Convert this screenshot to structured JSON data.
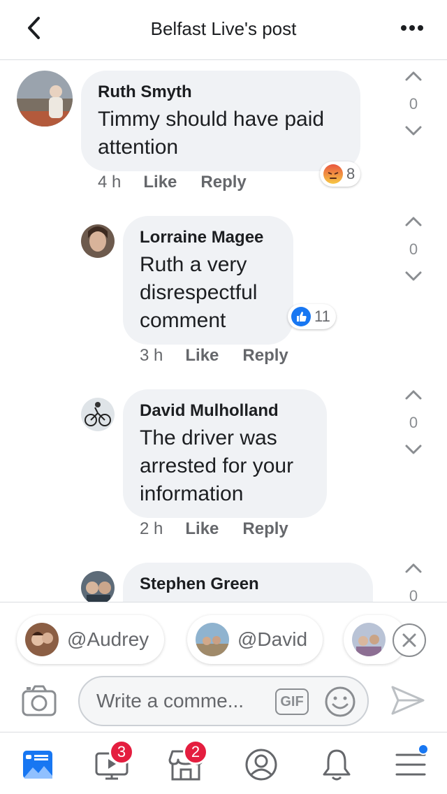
{
  "header": {
    "title": "Belfast Live's post",
    "back_icon": "chevron-left-icon",
    "more_icon": "more-horizontal-icon"
  },
  "comments": [
    {
      "author": "Ruth Smyth",
      "text": "Timmy should have paid attention",
      "time": "4 h",
      "like_label": "Like",
      "reply_label": "Reply",
      "reaction": {
        "type": "angry",
        "count": "8"
      },
      "vote_count": "0"
    },
    {
      "author": "Lorraine Magee",
      "text": "Ruth a very disrespectful comment",
      "time": "3 h",
      "like_label": "Like",
      "reply_label": "Reply",
      "reaction": {
        "type": "like",
        "count": "11"
      },
      "vote_count": "0"
    },
    {
      "author": "David Mulholland",
      "text": "The driver was arrested for your information",
      "time": "2 h",
      "like_label": "Like",
      "reply_label": "Reply",
      "vote_count": "0"
    },
    {
      "author": "Stephen Green",
      "vote_count": "0"
    }
  ],
  "mentions": [
    {
      "label": "@Audrey"
    },
    {
      "label": "@David"
    }
  ],
  "composer": {
    "placeholder": "Write a comme...",
    "gif_label": "GIF"
  },
  "bottom_nav": {
    "items": [
      {
        "name": "news-feed",
        "icon": "news-feed-icon"
      },
      {
        "name": "watch",
        "icon": "watch-video-icon",
        "badge": "3"
      },
      {
        "name": "marketplace",
        "icon": "marketplace-icon",
        "badge": "2"
      },
      {
        "name": "profile",
        "icon": "profile-icon"
      },
      {
        "name": "notifications",
        "icon": "bell-icon"
      },
      {
        "name": "menu",
        "icon": "menu-icon",
        "dot": true
      }
    ]
  },
  "colors": {
    "accent": "#1877f2",
    "badge": "#e41e3f",
    "bubble": "#f0f2f5",
    "muted": "#65676b"
  }
}
